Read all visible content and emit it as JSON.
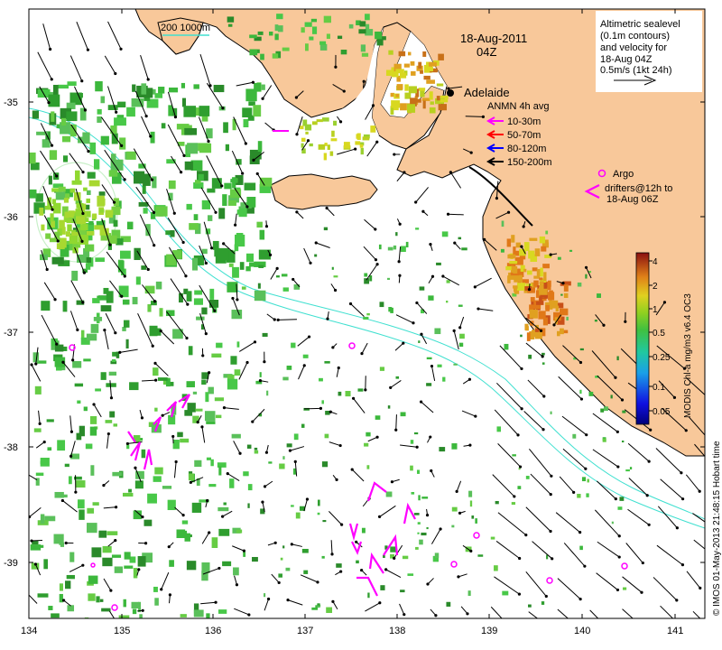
{
  "title": {
    "date": "18-Aug-2011",
    "time": "04Z"
  },
  "scale_bar": {
    "label": "200  1000m",
    "color": "#40e0d0"
  },
  "place": {
    "name": "Adelaide"
  },
  "legend_altimetric": {
    "lines": [
      "Altimetric sealevel",
      "(0.1m contours)",
      "and velocity for",
      "18-Aug 04Z",
      "0.5m/s (1kt 24h)"
    ]
  },
  "legend_anmn": {
    "title": "ANMN 4h avg",
    "items": [
      {
        "label": "10-30m",
        "color": "#ff00ff"
      },
      {
        "label": "50-70m",
        "color": "#ff0000"
      },
      {
        "label": "80-120m",
        "color": "#0000ff"
      },
      {
        "label": "150-200m",
        "color": "#000000"
      }
    ]
  },
  "legend_argo": {
    "argo_label": "Argo",
    "drifter_label_1": "drifters@12h to",
    "drifter_label_2": "18-Aug 06Z",
    "color": "#ff00ff"
  },
  "colorbar": {
    "title": "MODIS Chl-a mg/m3 v6.4 OC3",
    "ticks": [
      "4",
      "2",
      "1",
      "0.5",
      "0.25",
      "0.1",
      "0.05"
    ]
  },
  "axes": {
    "x_ticks": [
      "134",
      "135",
      "136",
      "137",
      "138",
      "139",
      "140",
      "141"
    ],
    "y_ticks": [
      "-35",
      "-36",
      "-37",
      "-38",
      "-39"
    ]
  },
  "credit": "© IMOS 01-May-2013 21:48:15 Hobart time",
  "colors": {
    "land": "#f8c89a",
    "contour": "#40e0d0",
    "chl_green": "#3cb83c",
    "chl_yellow": "#d8d820",
    "chl_orange": "#e07818"
  }
}
